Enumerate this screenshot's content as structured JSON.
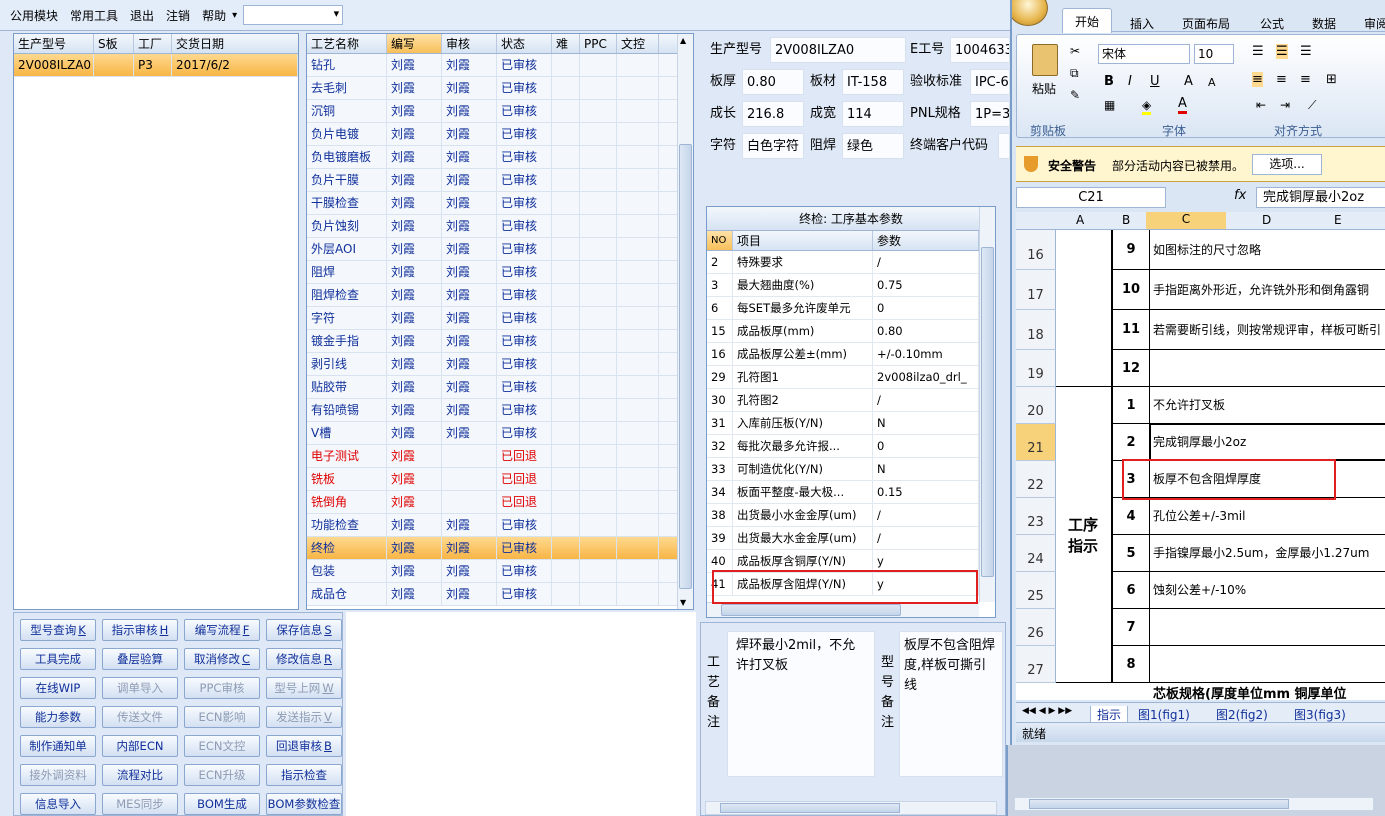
{
  "menubar": {
    "items": [
      "公用模块",
      "常用工具",
      "退出",
      "注销",
      "帮助"
    ]
  },
  "orders": {
    "headers": [
      "生产型号",
      "S板",
      "工厂",
      "交货日期"
    ],
    "rows": [
      {
        "model": "2V008ILZA0",
        "s_board": "",
        "factory": "P3",
        "date": "2017/6/2"
      }
    ]
  },
  "processes": {
    "headers": [
      "工艺名称",
      "编写",
      "审核",
      "状态",
      "难",
      "PPC",
      "文控"
    ],
    "rows": [
      {
        "name": "钻孔",
        "writer": "刘霞",
        "reviewer": "刘霞",
        "status": "已审核"
      },
      {
        "name": "去毛刺",
        "writer": "刘霞",
        "reviewer": "刘霞",
        "status": "已审核"
      },
      {
        "name": "沉铜",
        "writer": "刘霞",
        "reviewer": "刘霞",
        "status": "已审核"
      },
      {
        "name": "负片电镀",
        "writer": "刘霞",
        "reviewer": "刘霞",
        "status": "已审核"
      },
      {
        "name": "负电镀磨板",
        "writer": "刘霞",
        "reviewer": "刘霞",
        "status": "已审核"
      },
      {
        "name": "负片干膜",
        "writer": "刘霞",
        "reviewer": "刘霞",
        "status": "已审核"
      },
      {
        "name": "干膜检查",
        "writer": "刘霞",
        "reviewer": "刘霞",
        "status": "已审核"
      },
      {
        "name": "负片蚀刻",
        "writer": "刘霞",
        "reviewer": "刘霞",
        "status": "已审核"
      },
      {
        "name": "外层AOI",
        "writer": "刘霞",
        "reviewer": "刘霞",
        "status": "已审核"
      },
      {
        "name": "阻焊",
        "writer": "刘霞",
        "reviewer": "刘霞",
        "status": "已审核"
      },
      {
        "name": "阻焊检查",
        "writer": "刘霞",
        "reviewer": "刘霞",
        "status": "已审核"
      },
      {
        "name": "字符",
        "writer": "刘霞",
        "reviewer": "刘霞",
        "status": "已审核"
      },
      {
        "name": "镀金手指",
        "writer": "刘霞",
        "reviewer": "刘霞",
        "status": "已审核"
      },
      {
        "name": "剥引线",
        "writer": "刘霞",
        "reviewer": "刘霞",
        "status": "已审核"
      },
      {
        "name": "贴胶带",
        "writer": "刘霞",
        "reviewer": "刘霞",
        "status": "已审核"
      },
      {
        "name": "有铅喷锡",
        "writer": "刘霞",
        "reviewer": "刘霞",
        "status": "已审核"
      },
      {
        "name": "V槽",
        "writer": "刘霞",
        "reviewer": "刘霞",
        "status": "已审核"
      },
      {
        "name": "电子测试",
        "writer": "刘霞",
        "reviewer": "",
        "status": "已回退"
      },
      {
        "name": "铣板",
        "writer": "刘霞",
        "reviewer": "",
        "status": "已回退"
      },
      {
        "name": "铣倒角",
        "writer": "刘霞",
        "reviewer": "",
        "status": "已回退"
      },
      {
        "name": "功能检查",
        "writer": "刘霞",
        "reviewer": "刘霞",
        "status": "已审核"
      },
      {
        "name": "终检",
        "writer": "刘霞",
        "reviewer": "刘霞",
        "status": "已审核"
      },
      {
        "name": "包装",
        "writer": "刘霞",
        "reviewer": "刘霞",
        "status": "已审核"
      },
      {
        "name": "成品仓",
        "writer": "刘霞",
        "reviewer": "刘霞",
        "status": "已审核"
      }
    ]
  },
  "buttons": [
    {
      "label": "型号查询",
      "key": "K",
      "enabled": true
    },
    {
      "label": "指示审核",
      "key": "H",
      "enabled": true
    },
    {
      "label": "编写流程",
      "key": "F",
      "enabled": true
    },
    {
      "label": "保存信息",
      "key": "S",
      "enabled": true
    },
    {
      "label": "工具完成",
      "key": "",
      "enabled": true
    },
    {
      "label": "叠层验算",
      "key": "",
      "enabled": true
    },
    {
      "label": "取消修改",
      "key": "C",
      "enabled": true
    },
    {
      "label": "修改信息",
      "key": "R",
      "enabled": true
    },
    {
      "label": "在线WIP",
      "key": "",
      "enabled": true
    },
    {
      "label": "调单导入",
      "key": "",
      "enabled": false
    },
    {
      "label": "PPC审核",
      "key": "",
      "enabled": false
    },
    {
      "label": "型号上网",
      "key": "W",
      "enabled": false
    },
    {
      "label": "能力参数",
      "key": "",
      "enabled": true
    },
    {
      "label": "传送文件",
      "key": "",
      "enabled": false
    },
    {
      "label": "ECN影响",
      "key": "",
      "enabled": false
    },
    {
      "label": "发送指示",
      "key": "V",
      "enabled": false
    },
    {
      "label": "制作通知单",
      "key": "",
      "enabled": true
    },
    {
      "label": "内部ECN",
      "key": "",
      "enabled": true
    },
    {
      "label": "ECN文控",
      "key": "",
      "enabled": false
    },
    {
      "label": "回退审核",
      "key": "B",
      "enabled": true
    },
    {
      "label": "接外调资料",
      "key": "",
      "enabled": false
    },
    {
      "label": "流程对比",
      "key": "",
      "enabled": true
    },
    {
      "label": "ECN升级",
      "key": "",
      "enabled": false
    },
    {
      "label": "指示检查",
      "key": "",
      "enabled": true
    },
    {
      "label": "信息导入",
      "key": "",
      "enabled": true
    },
    {
      "label": "MES同步",
      "key": "",
      "enabled": false
    },
    {
      "label": "BOM生成",
      "key": "",
      "enabled": true
    },
    {
      "label": "BOM参数检查",
      "key": "",
      "enabled": true
    }
  ],
  "info": {
    "model_label": "生产型号",
    "model": "2V008ILZA0",
    "eno_label": "E工号",
    "eno": "1004633",
    "thick_label": "板厚",
    "thick": "0.80",
    "material_label": "板材",
    "material": "IT-158",
    "std_label": "验收标准",
    "std": "IPC-6",
    "len_label": "成长",
    "len": "216.8",
    "wid_label": "成宽",
    "wid": "114",
    "pnl_label": "PNL规格",
    "pnl": "1P=3",
    "char_label": "字符",
    "char": "白色字符",
    "mask_label": "阻焊",
    "mask": "绿色",
    "cust_label": "终端客户代码",
    "cust": ""
  },
  "params": {
    "title": "终检: 工序基本参数",
    "headers": [
      "NO",
      "项目",
      "参数"
    ],
    "rows": [
      {
        "no": "2",
        "item": "特殊要求",
        "val": "/"
      },
      {
        "no": "3",
        "item": "最大翘曲度(%)",
        "val": "0.75"
      },
      {
        "no": "6",
        "item": "每SET最多允许废单元",
        "val": "0"
      },
      {
        "no": "15",
        "item": "成品板厚(mm)",
        "val": "0.80"
      },
      {
        "no": "16",
        "item": "成品板厚公差±(mm)",
        "val": "+/-0.10mm"
      },
      {
        "no": "29",
        "item": "孔符图1",
        "val": "2v008ilza0_drl_"
      },
      {
        "no": "30",
        "item": "孔符图2",
        "val": "/"
      },
      {
        "no": "31",
        "item": "入库前压板(Y/N)",
        "val": "N"
      },
      {
        "no": "32",
        "item": "每批次最多允许报...",
        "val": "0"
      },
      {
        "no": "33",
        "item": "可制造优化(Y/N)",
        "val": "N"
      },
      {
        "no": "34",
        "item": "板面平整度-最大极...",
        "val": "0.15"
      },
      {
        "no": "38",
        "item": "出货最小水金金厚(um)",
        "val": "/"
      },
      {
        "no": "39",
        "item": "出货最大水金金厚(um)",
        "val": "/"
      },
      {
        "no": "40",
        "item": "成品板厚含铜厚(Y/N)",
        "val": "y"
      },
      {
        "no": "41",
        "item": "成品板厚含阻焊(Y/N)",
        "val": "y"
      }
    ]
  },
  "notes": {
    "craft_label": "工艺备注",
    "craft_text": "焊环最小2mil，不允许打叉板",
    "model_label": "型号备注",
    "model_text": "板厚不包含阻焊度,样板可撕引线"
  },
  "excel": {
    "tabs": [
      "开始",
      "插入",
      "页面布局",
      "公式",
      "数据",
      "审阅"
    ],
    "font_name": "宋体",
    "font_size": "10",
    "paste_label": "粘贴",
    "groups": [
      "剪贴板",
      "字体",
      "对齐方式"
    ],
    "security_title": "安全警告",
    "security_msg": "部分活动内容已被禁用。",
    "options_btn": "选项...",
    "name_box": "C21",
    "formula": "完成铜厚最小2oz",
    "col_headers": [
      "A",
      "B",
      "C",
      "D",
      "E"
    ],
    "rows": [
      {
        "r": "16",
        "b": "9",
        "c": "如图标注的尺寸忽略"
      },
      {
        "r": "17",
        "b": "10",
        "c": "手指距离外形近，允许铣外形和倒角露铜"
      },
      {
        "r": "18",
        "b": "11",
        "c": "若需要断引线，则按常规评审，样板可断引"
      },
      {
        "r": "19",
        "b": "12",
        "c": ""
      },
      {
        "r": "20",
        "b": "1",
        "c": "不允许打叉板"
      },
      {
        "r": "21",
        "b": "2",
        "c": "完成铜厚最小2oz"
      },
      {
        "r": "22",
        "b": "3",
        "c": "板厚不包含阻焊厚度"
      },
      {
        "r": "23",
        "b": "4",
        "c": "孔位公差+/-3mil"
      },
      {
        "r": "24",
        "b": "5",
        "c": "手指镍厚最小2.5um，金厚最小1.27um"
      },
      {
        "r": "25",
        "b": "6",
        "c": "蚀刻公差+/-10%"
      },
      {
        "r": "26",
        "b": "7",
        "c": ""
      },
      {
        "r": "27",
        "b": "8",
        "c": ""
      }
    ],
    "section_label": "工序指示",
    "partial_row": "芯板规格(厚度单位mm  铜厚单位",
    "sheets": [
      "指示",
      "图1(fig1)",
      "图2(fig2)",
      "图3(fig3)"
    ],
    "status": "就绪"
  }
}
